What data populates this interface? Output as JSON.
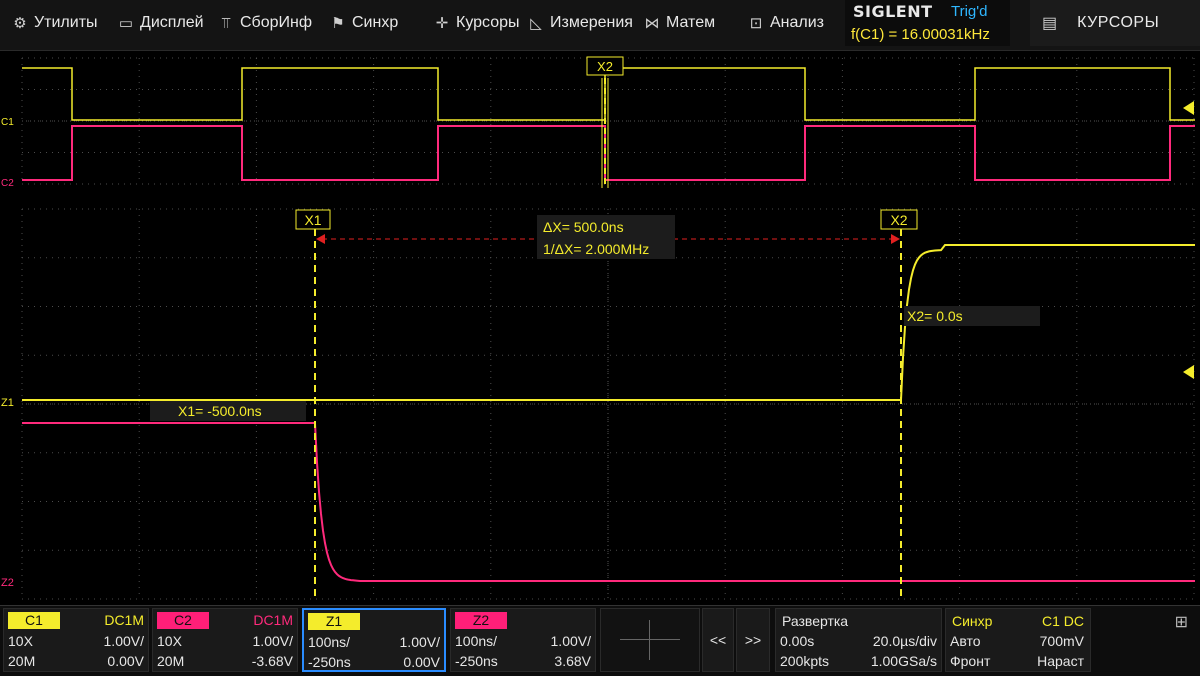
{
  "menu": [
    {
      "label": "Утилиты",
      "icon": "gear-icon",
      "glyph": "⚙"
    },
    {
      "label": "Дисплей",
      "icon": "monitor-icon",
      "glyph": "▭"
    },
    {
      "label": "СборИнф",
      "icon": "acquire-icon",
      "glyph": "⫪"
    },
    {
      "label": "Синхр",
      "icon": "flag-icon",
      "glyph": "⚑"
    },
    {
      "label": "Курсоры",
      "icon": "cursor-cross-icon",
      "glyph": "✛"
    },
    {
      "label": "Измерения",
      "icon": "measure-icon",
      "glyph": "◺"
    },
    {
      "label": "Матем",
      "icon": "math-icon",
      "glyph": "⋈"
    },
    {
      "label": "Анализ",
      "icon": "analysis-icon",
      "glyph": "⊡"
    }
  ],
  "brand": {
    "logo": "SIGLENT",
    "trig_status": "Trig'd",
    "frequency": "f(C1) = 16.00031kHz"
  },
  "panel": {
    "title": "КУРСОРЫ",
    "icon": "list-icon"
  },
  "colors": {
    "c1": "#f4ec2c",
    "c2": "#ff1f78",
    "z1_border": "#2a8cff",
    "grid": "#5a5a5a"
  },
  "overview": {
    "cursor_label": "X2",
    "c1_label": "C1",
    "c2_label": "C2"
  },
  "zoom": {
    "x1_label": "X1",
    "x2_label": "X2",
    "delta_x": "ΔX= 500.0ns",
    "inv_delta_x": "1/ΔX= 2.000MHz",
    "x1_value": "X1= -500.0ns",
    "x2_value": "X2= 0.0s",
    "z1_label": "Z1",
    "z2_label": "Z2"
  },
  "channels": [
    {
      "name": "C1",
      "coupling": "DC1M",
      "probe": "10X",
      "scale": "1.00V/",
      "bw": "20M",
      "offset": "0.00V"
    },
    {
      "name": "C2",
      "coupling": "DC1M",
      "probe": "10X",
      "scale": "1.00V/",
      "bw": "20M",
      "offset": "-3.68V"
    },
    {
      "name": "Z1",
      "coupling": "",
      "probe": "100ns/",
      "scale": "1.00V/",
      "bw": "-250ns",
      "offset": "0.00V"
    },
    {
      "name": "Z2",
      "coupling": "",
      "probe": "100ns/",
      "scale": "1.00V/",
      "bw": "-250ns",
      "offset": "3.68V"
    }
  ],
  "nav": {
    "prev": "<<",
    "next": ">>"
  },
  "timebase": {
    "title": "Развертка",
    "delay": "0.00s",
    "scale": "20.0µs/div",
    "depth": "200kpts",
    "rate": "1.00GSa/s"
  },
  "trigger": {
    "title": "Синхр",
    "source": "C1 DC",
    "mode": "Авто",
    "level": "700mV",
    "type": "Фронт",
    "slope": "Нараст"
  },
  "network_icon": "network-icon"
}
